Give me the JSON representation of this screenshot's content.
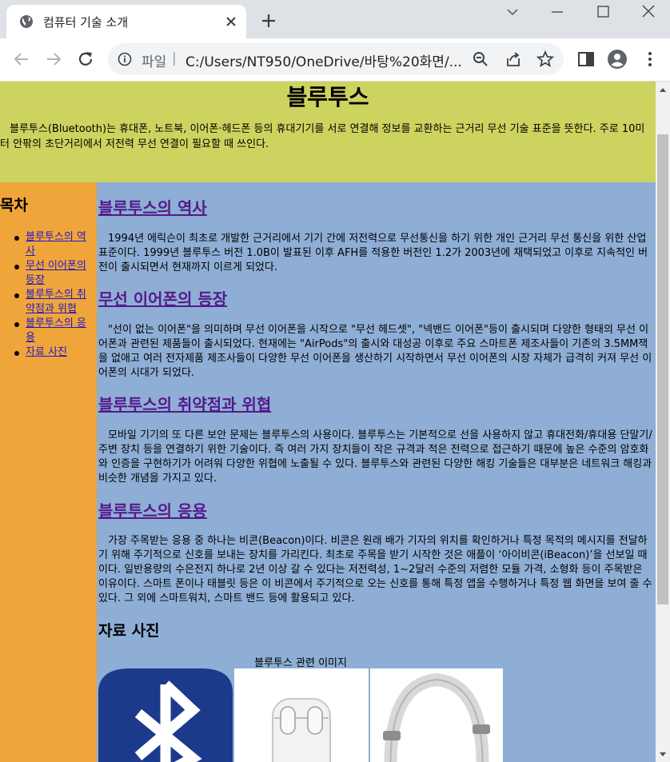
{
  "tab": {
    "title": "컴퓨터 기술 소개"
  },
  "address_bar": {
    "scheme_label": "파일",
    "separator": "|",
    "url": "C:/Users/NT950/OneDrive/바탕%20화면/..."
  },
  "page": {
    "title": "블루투스",
    "intro": "블루투스(Bluetooth)는 휴대폰, 노트북, 이어폰·헤드폰 등의 휴대기기를 서로 연결해 정보를 교환하는 근거리 무선 기술 표준을 뜻한다. 주로 10미터 안팎의 초단거리에서 저전력 무선 연결이 필요할 때 쓰인다.",
    "toc": {
      "heading": "목차",
      "items": [
        {
          "label": "블루투스의 역사"
        },
        {
          "label": "무선 이어폰의 등장"
        },
        {
          "label": "블루투스의 취약점과 위협"
        },
        {
          "label": "블루투스의 응용"
        },
        {
          "label": "자료 사진"
        }
      ]
    },
    "sections": [
      {
        "heading": "블루투스의 역사",
        "body": "1994년 에릭슨이 최초로 개발한 근거리에서 기기 간에 저전력으로 무선통신을 하기 위한 개인 근거리 무선 통신을 위한 산업 표준이다. 1999년 블루투스 버전 1.0B이 발표된 이후 AFH를 적용한 버전인 1.2가 2003년에 채택되었고 이후로 지속적인 버전이 출시되면서 현재까지 이르게 되었다."
      },
      {
        "heading": "무선 이어폰의 등장",
        "body": "\"선이 없는 이어폰\"을 의미하며 무선 이어폰을 시작으로 \"무선 헤드셋\", \"넥밴드 이어폰\"등이 출시되며 다양한 형태의 무선 이어폰과 관련된 제품들이 출시되었다. 현재에는 \"AirPods\"의 출시와 대성공 이후로 주요 스마트폰 제조사들이 기존의 3.5MM잭을 없애고 여러 전자제품 제조사들이 다양한 무선 이어폰을 생산하기 시작하면서 무선 이어폰의 시장 자체가 급격히 커져 무선 이어폰의 시대가 되었다."
      },
      {
        "heading": "블루투스의 취약점과 위협",
        "body": "모바일 기기의 또 다른 보안 문제는 블루투스의 사용이다. 블루투스는 기본적으로 선을 사용하지 않고 휴대전화/휴대용 단말기/주변 장치 등을 연결하기 위한 기술이다. 즉 여러 가지 장치들이 작은 규격과 적은 전력으로 접근하기 때문에 높은 수준의 암호화와 인증을 구현하기가 어려워 다양한 위협에 노출될 수 있다. 블루투스와 관련된 다양한 해킹 기술들은 대부분은 네트워크 해킹과 비슷한 개념을 가지고 있다."
      },
      {
        "heading": "블루투스의 응용",
        "body": "가장 주목받는 응용 중 하나는 비콘(Beacon)이다. 비콘은 원래 배가 기자의 위치를 확인하거나 특정 목적의 메시지를 전달하기 위해 주기적으로 신호를 보내는 장치를 가리킨다. 최초로 주목을 받기 시작한 것은 애플이 ‘아이비콘(iBeacon)’을 선보일 때이다. 일반용량의 수은전지 하나로 2년 이상 갈 수 있다는 저전력성, 1~2달러 수준의 저렴한 모듈 가격, 소형화 등이 주목받은 이유이다. 스마트 폰이나 태블릿 등은 이 비콘에서 주기적으로 오는 신호를 통해 특정 앱을 수행하거나 특정 웹 화면을 보여 줄 수 있다. 그 외에 스마트워치, 스마트 밴드 등에 활용되고 있다."
      }
    ],
    "gallery": {
      "heading": "자료 사진",
      "caption": "블루투스 관련 이미지",
      "images": [
        {
          "icon": "bluetooth-logo"
        },
        {
          "icon": "airpods-case"
        },
        {
          "icon": "headphones"
        }
      ]
    }
  },
  "colors": {
    "header_bg": "#cdd35f",
    "sidebar_bg": "#efa53a",
    "main_bg": "#8eaed5",
    "link": "#2418c8",
    "visited_heading": "#551a8b",
    "bluetooth_blue": "#1b3a8c"
  }
}
